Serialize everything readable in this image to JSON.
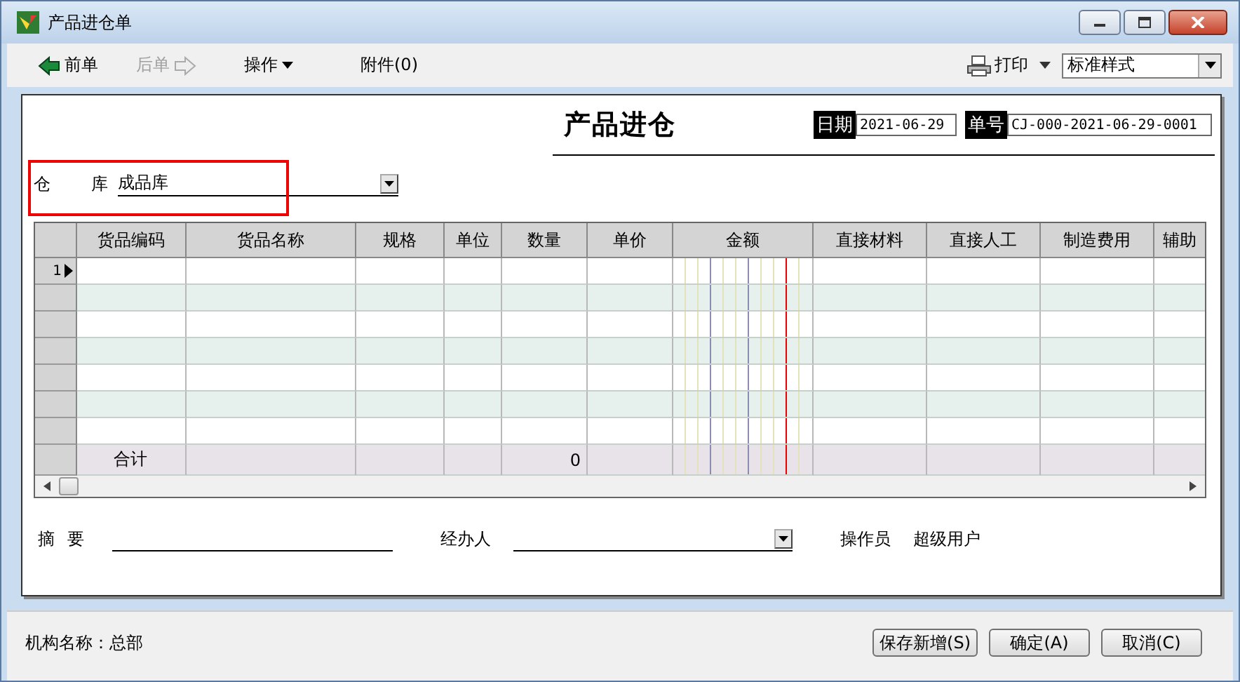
{
  "window": {
    "title": "产品进仓单"
  },
  "toolbar": [
    {
      "kind": "back",
      "label": "前单",
      "disabled": false
    },
    {
      "kind": "forward",
      "label": "后单",
      "disabled": true
    },
    {
      "kind": "menu",
      "label": "操作",
      "disabled": false
    },
    {
      "kind": "plain",
      "label": "附件(0)",
      "disabled": false
    }
  ],
  "print": {
    "label": "打印"
  },
  "style_select": {
    "value": "标准样式"
  },
  "form": {
    "title": "产品进仓",
    "date_label": "日期",
    "date": "2021-06-29",
    "number_label": "单号",
    "number": "CJ-000-2021-06-29-0001",
    "warehouse_label_1": "仓",
    "warehouse_label_2": "库",
    "warehouse": "成品库"
  },
  "table": {
    "columns": [
      "货品编码",
      "货品名称",
      "规格",
      "单位",
      "数量",
      "单价",
      "金额",
      "直接材料",
      "直接人工",
      "制造费用",
      "辅助"
    ],
    "rows": [
      {
        "row_number": "1",
        "current": true
      },
      {
        "current": false
      },
      {
        "current": false
      },
      {
        "current": false
      },
      {
        "current": false
      },
      {
        "current": false
      },
      {
        "current": false
      }
    ],
    "totals": {
      "label": "合计",
      "quantity": "0"
    }
  },
  "footer": {
    "summary_label_1": "摘",
    "summary_label_2": "要",
    "handler_label": "经办人",
    "operator_label": "操作员",
    "operator": "超级用户"
  },
  "status_bar": {
    "text": "机构名称：总部"
  },
  "buttons": [
    "保存新增(S)",
    "确定(A)",
    "取消(C)"
  ]
}
